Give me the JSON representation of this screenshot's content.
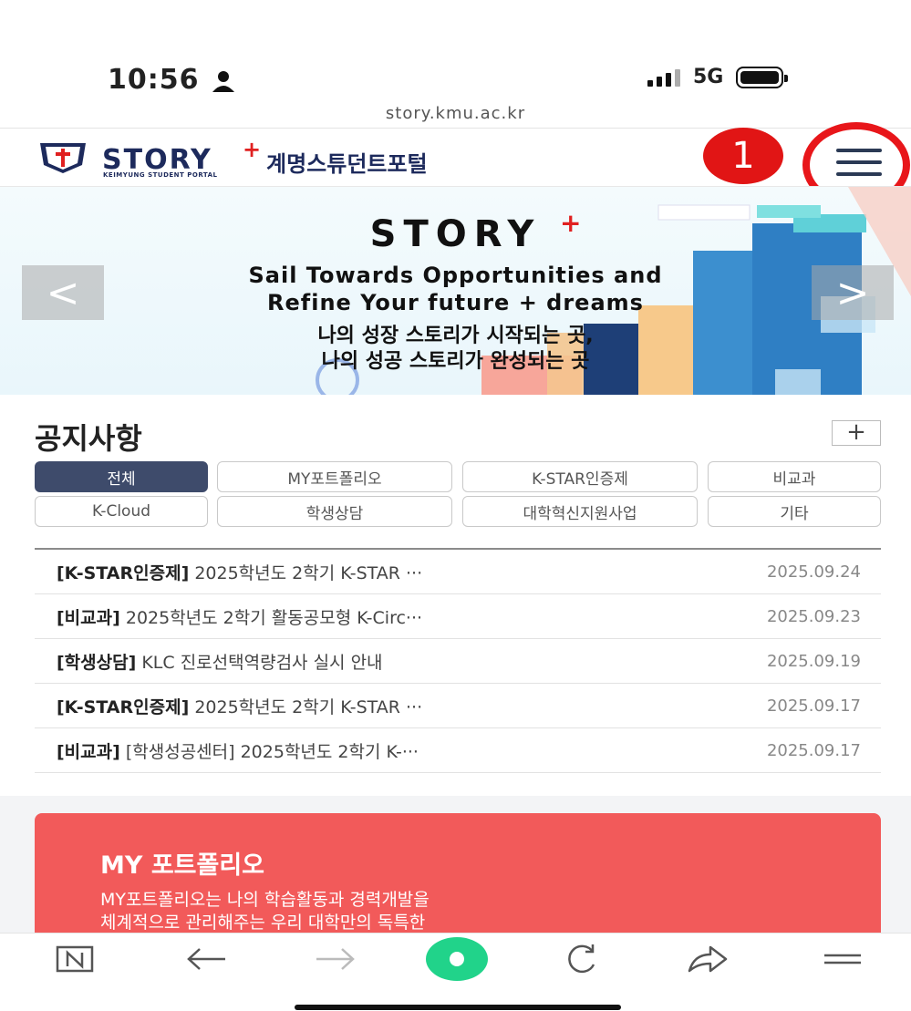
{
  "status_bar": {
    "time": "10:56",
    "network": "5G"
  },
  "browser": {
    "url": "story.kmu.ac.kr"
  },
  "header": {
    "logo_word": "STORY",
    "logo_plus": "+",
    "logo_sub": "KEIMYUNG STUDENT PORTAL",
    "logo_kr": "계명스튜던트포털",
    "badge": "1"
  },
  "banner": {
    "title": "STORY",
    "title_plus": "+",
    "line1": "Sail Towards Opportunities and",
    "line2": "Refine Your future + dreams",
    "kr_line1": "나의 성장 스토리가 시작되는 곳,",
    "kr_line2": "나의 성공 스토리가 완성되는 곳",
    "prev": "<",
    "next": ">"
  },
  "notices": {
    "title": "공지사항",
    "more": "+",
    "categories": [
      "전체",
      "MY포트폴리오",
      "K-STAR인증제",
      "비교과",
      "K-Cloud",
      "학생상담",
      "대학혁신지원사업",
      "기타"
    ],
    "items": [
      {
        "tag": "[K-STAR인증제]",
        "text": " 2025학년도 2학기 K-STAR ···",
        "date": "2025.09.24"
      },
      {
        "tag": "[비교과]",
        "text": " 2025학년도 2학기 활동공모형 K-Circ···",
        "date": "2025.09.23"
      },
      {
        "tag": "[학생상담]",
        "text": " KLC 진로선택역량검사 실시 안내",
        "date": "2025.09.19"
      },
      {
        "tag": "[K-STAR인증제]",
        "text": " 2025학년도 2학기 K-STAR ···",
        "date": "2025.09.17"
      },
      {
        "tag": "[비교과]",
        "text": " [학생성공센터] 2025학년도 2학기 K-···",
        "date": "2025.09.17"
      }
    ]
  },
  "portfolio": {
    "title": "MY 포트폴리오",
    "desc1": "MY포트폴리오는 나의 학습활동과 경력개발을",
    "desc2": "체계적으로 관리해주는 우리 대학만의 독특한"
  },
  "colors": {
    "accent": "#3e4b6b",
    "brand_red": "#e11515",
    "navy": "#1d2a5c",
    "portfolio": "#f25a5a"
  }
}
